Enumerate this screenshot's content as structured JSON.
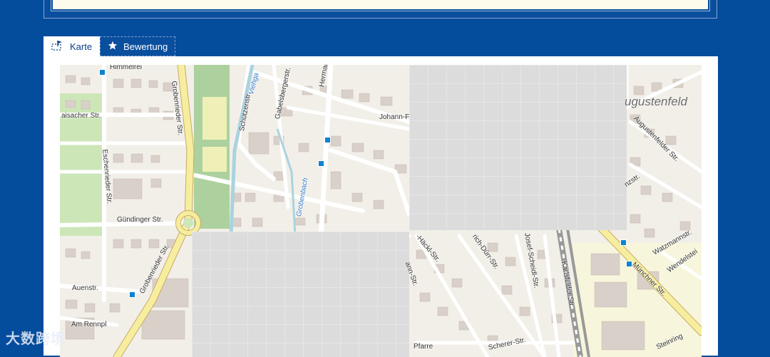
{
  "tabs": [
    {
      "label": "Karte",
      "icon": "map-flag-icon",
      "active": true
    },
    {
      "label": "Bewertung",
      "icon": "star-icon",
      "active": false
    }
  ],
  "map": {
    "district_label": "ugustenfeld",
    "streets": {
      "himmelreich": "Himmelrei",
      "hermann": "Hermann-",
      "johann": "Johann-F",
      "gabelsberger": "Gabelsbergerstr.",
      "schuetzen": "Schützenstr.",
      "viehgasse": "Viehga",
      "aisacher": "aisacher Str.",
      "grobenrieder_top": "Grobenrieder Str.",
      "eschenrieder": "Eschenrieder Str.",
      "guendinger": "Gündinger Str.",
      "grobenrieder_bottom": "Grobenrieder Str.",
      "auen": "Auenstr.",
      "am_rennpl": "Am Rennpl",
      "grobenbach": "Grobenbach",
      "augustenfelder": "Augustenfelder Str.",
      "haeckl": "-Häckl-Str.",
      "duerr": "rich-Dürr-Str.",
      "josef_scheidl": "Josef-Scheidl-Str.",
      "karlsfelder": "Karlsfelder Str.",
      "muenchner": "Münchner Str.",
      "watzmann": "Watzmannstr.",
      "wendelstein": "Wendelstei",
      "nz": "nzstr.",
      "an": "ann-Str.",
      "pfarrer": "Pfarre",
      "scherer": "Scherer-Str.",
      "steinring": "Steinring"
    }
  },
  "watermark": "大数跨境",
  "colors": {
    "page_bg": "#044c9c",
    "tab_active_text": "#0a3f86",
    "bus_stop": "#0e83d1"
  }
}
